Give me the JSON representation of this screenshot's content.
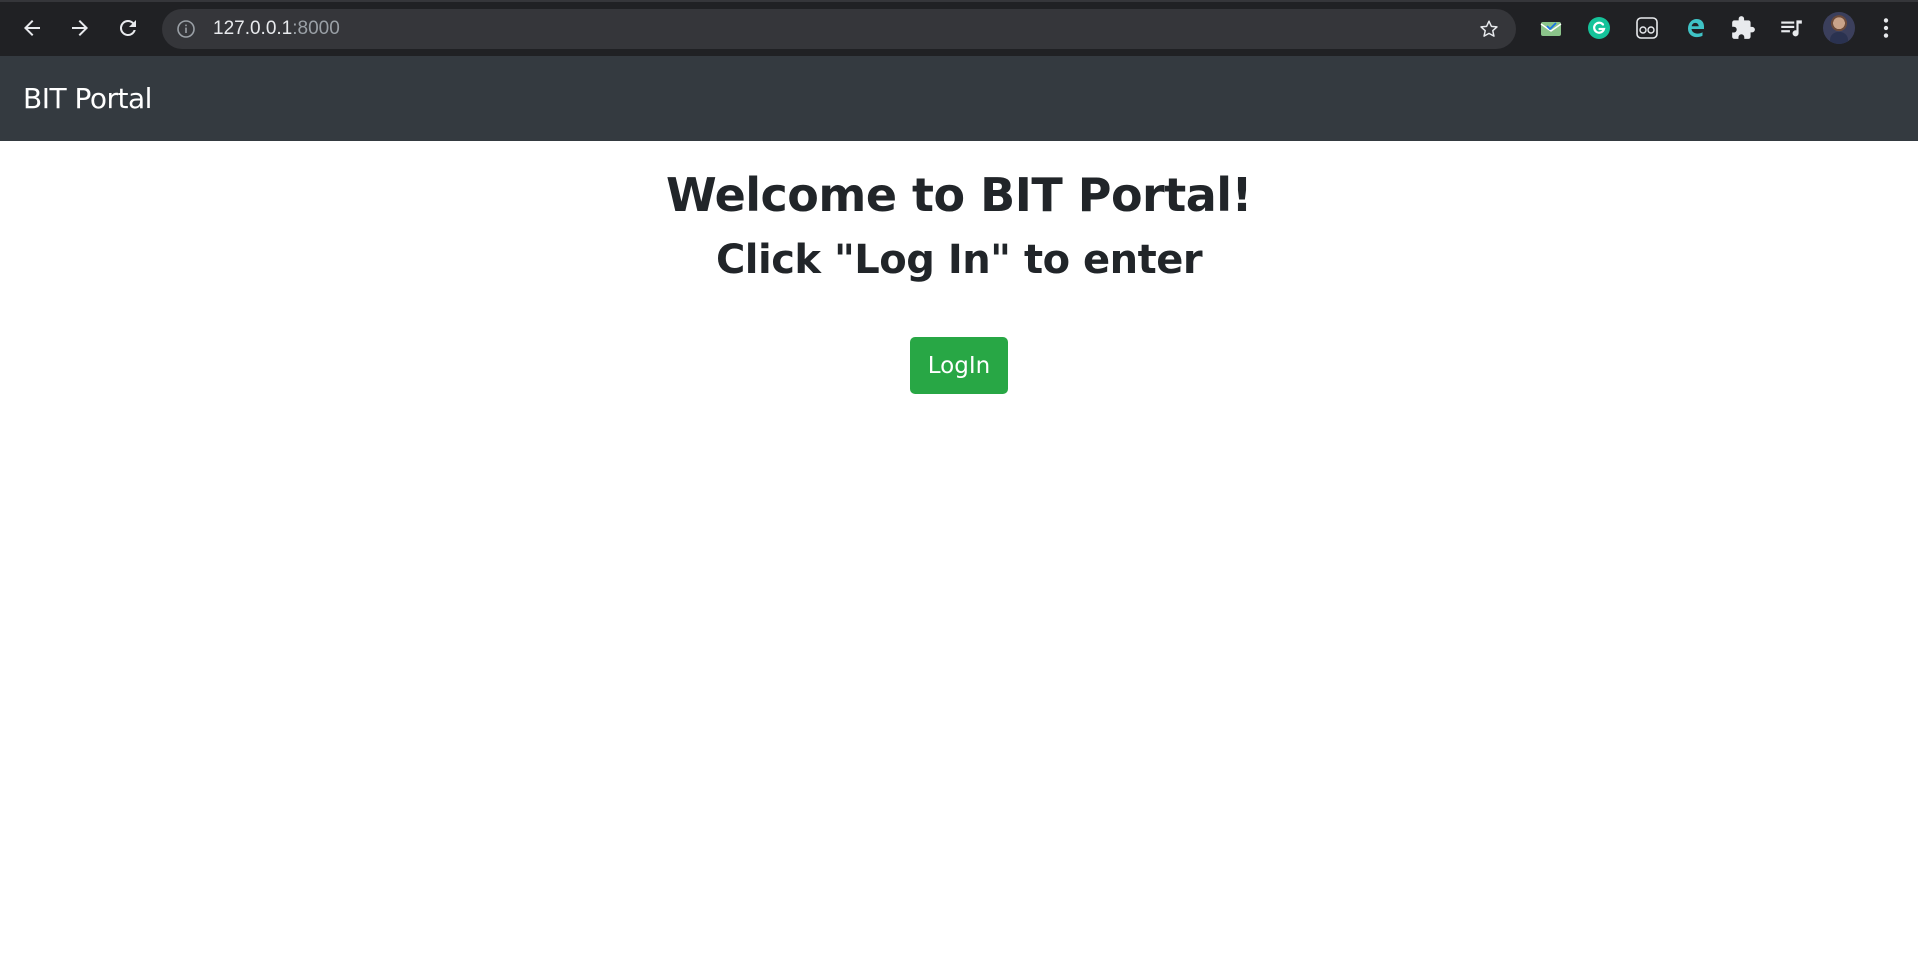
{
  "browser": {
    "url_host": "127.0.0.1",
    "url_port": ":8000",
    "icons": {
      "back": "back-arrow-icon",
      "forward": "forward-arrow-icon",
      "reload": "reload-icon",
      "site_info": "info-icon",
      "bookmark": "star-icon",
      "extensions": [
        "mail-check-extension-icon",
        "grammarly-icon",
        "reader-mode-icon",
        "edge-icon",
        "puzzle-extensions-icon",
        "media-queue-icon"
      ],
      "menu": "kebab-menu-icon"
    }
  },
  "navbar": {
    "brand": "BIT Portal"
  },
  "main": {
    "title": "Welcome to BIT Portal!",
    "subtitle": "Click \"Log In\" to enter",
    "login_label": "LogIn"
  },
  "colors": {
    "navbar_bg": "#343a40",
    "button_bg": "#28a745",
    "text": "#212529"
  }
}
